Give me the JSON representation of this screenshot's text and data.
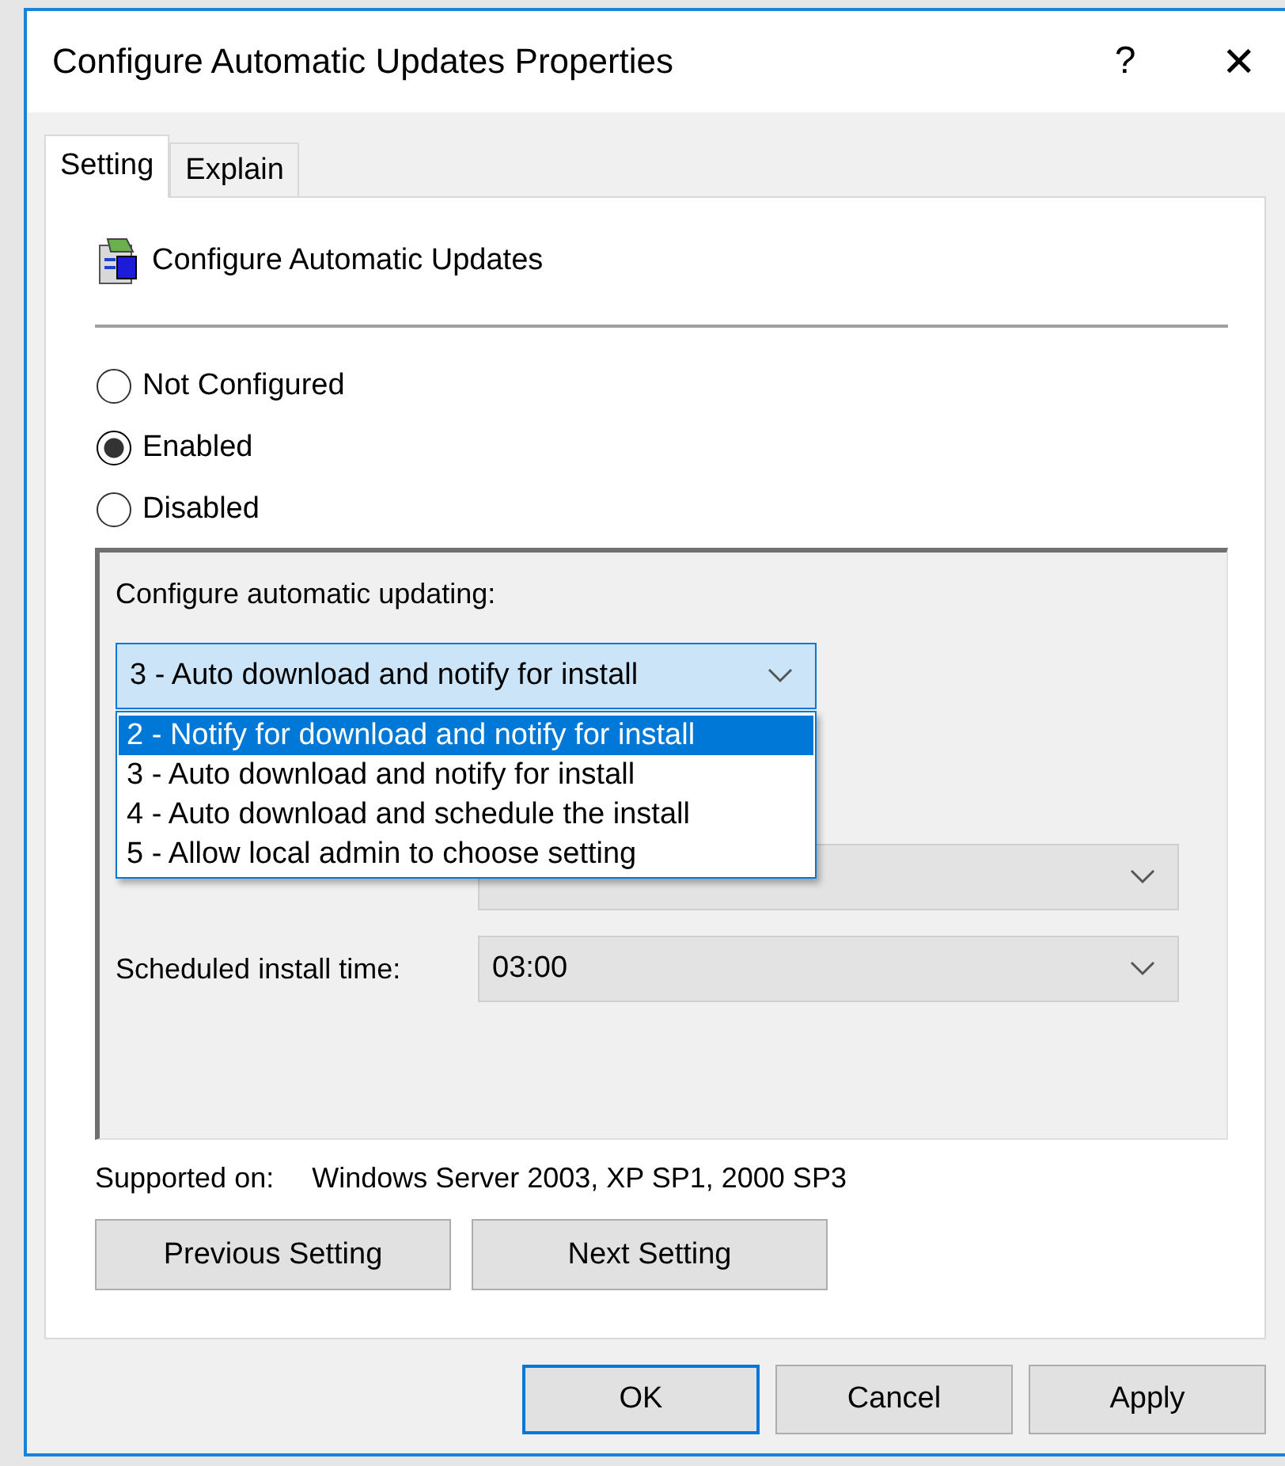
{
  "window": {
    "title": "Configure Automatic Updates Properties",
    "help": "?",
    "close": "✕"
  },
  "tabs": [
    {
      "label": "Setting",
      "selected": true
    },
    {
      "label": "Explain",
      "selected": false
    }
  ],
  "policy_title": "Configure Automatic Updates",
  "options": [
    {
      "label": "Not Configured",
      "selected": false
    },
    {
      "label": "Enabled",
      "selected": true
    },
    {
      "label": "Disabled",
      "selected": false
    }
  ],
  "group": {
    "label": "Configure automatic updating:",
    "value": "3 - Auto download and notify for install",
    "dropdown": [
      {
        "label": "2 - Notify for download and notify for install",
        "highlighted": true
      },
      {
        "label": "3 - Auto download and notify for install",
        "highlighted": false
      },
      {
        "label": "4 - Auto download and schedule the install",
        "highlighted": false
      },
      {
        "label": "5 - Allow local admin to choose setting",
        "highlighted": false
      }
    ],
    "fields": [
      {
        "label": "Scheduled install time:",
        "value": "03:00"
      }
    ]
  },
  "supported": {
    "label": "Supported on:",
    "value": "Windows Server 2003, XP SP1, 2000 SP3"
  },
  "nav_buttons": [
    "Previous Setting",
    "Next Setting"
  ],
  "buttons": [
    {
      "label": "OK",
      "default": true
    },
    {
      "label": "Cancel",
      "default": false
    },
    {
      "label": "Apply",
      "default": false
    }
  ]
}
